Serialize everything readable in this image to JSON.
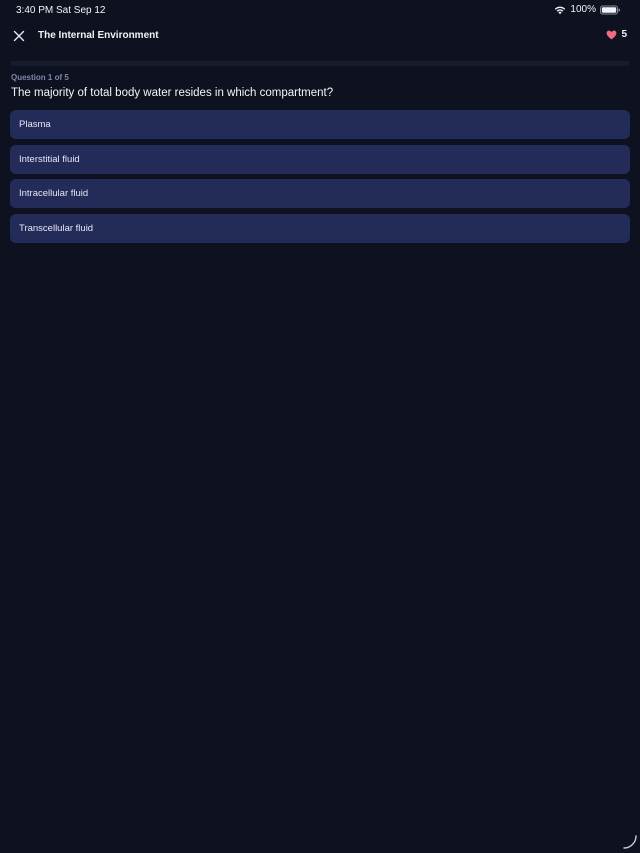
{
  "status_bar": {
    "time": "3:40 PM",
    "date": "Sat Sep 12",
    "battery": "100%",
    "icons": [
      "wifi-icon",
      "battery-icon"
    ]
  },
  "header": {
    "title": "The Internal Environment",
    "close_icon": "close-icon",
    "lives_icon": "heart-icon",
    "lives_count": "5"
  },
  "progress": {
    "value": 0.0
  },
  "question": {
    "counter": "Question 1 of 5",
    "text": "The majority of total body water resides in which compartment?",
    "options": [
      {
        "label": "Plasma"
      },
      {
        "label": "Interstitial fluid"
      },
      {
        "label": "Intracellular fluid"
      },
      {
        "label": "Transcellular fluid"
      }
    ]
  },
  "colors": {
    "background": "#0e1120",
    "option_background": "#232b59",
    "heart": "#f06b7e",
    "counter_text": "#7e87a6"
  }
}
